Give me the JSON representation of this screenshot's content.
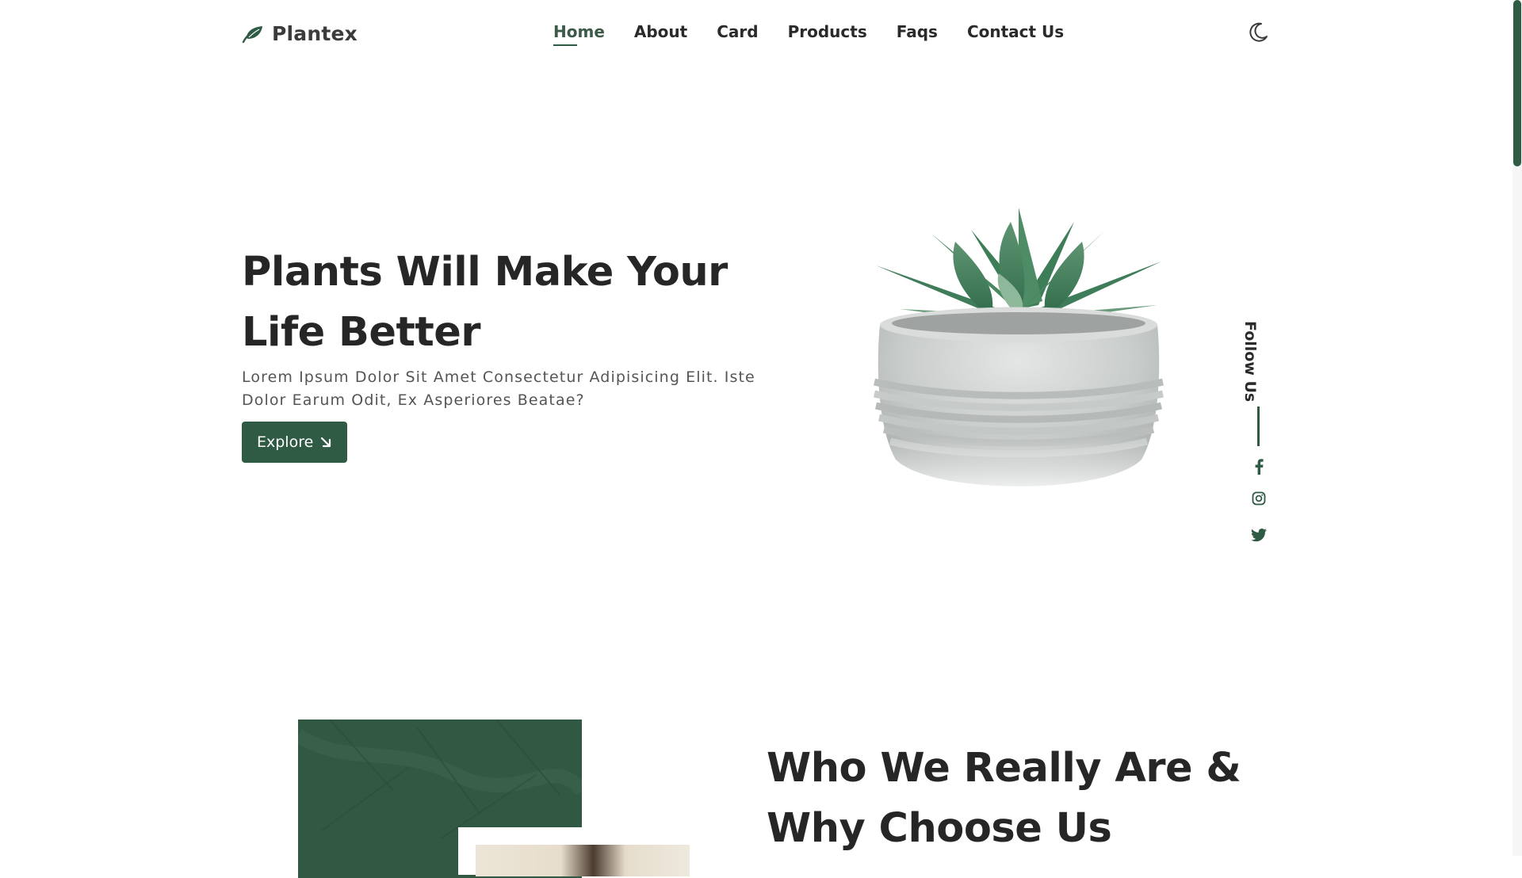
{
  "header": {
    "logo_text": "Plantex",
    "nav": [
      {
        "label": "Home",
        "active": true
      },
      {
        "label": "About"
      },
      {
        "label": "Card"
      },
      {
        "label": "Products"
      },
      {
        "label": "Faqs"
      },
      {
        "label": "Contact Us"
      }
    ],
    "theme_icon": "moon-icon"
  },
  "hero": {
    "title": "Plants Will Make Your Life Better",
    "description": "Lorem Ipsum Dolor Sit Amet Consectetur Adipisicing Elit. Iste Dolor Earum Odit, Ex Asperiores Beatae?",
    "button_label": "Explore",
    "button_icon": "arrow-down-right-icon",
    "image": "succulent-in-concrete-pot"
  },
  "social": {
    "label": "Follow Us",
    "icons": [
      "facebook-icon",
      "instagram-icon",
      "twitter-icon"
    ]
  },
  "about": {
    "title": "Who We Really Are & Why Choose Us"
  },
  "colors": {
    "accent": "#2f5a44",
    "text": "#262626",
    "muted": "#555555",
    "background": "#ffffff"
  }
}
